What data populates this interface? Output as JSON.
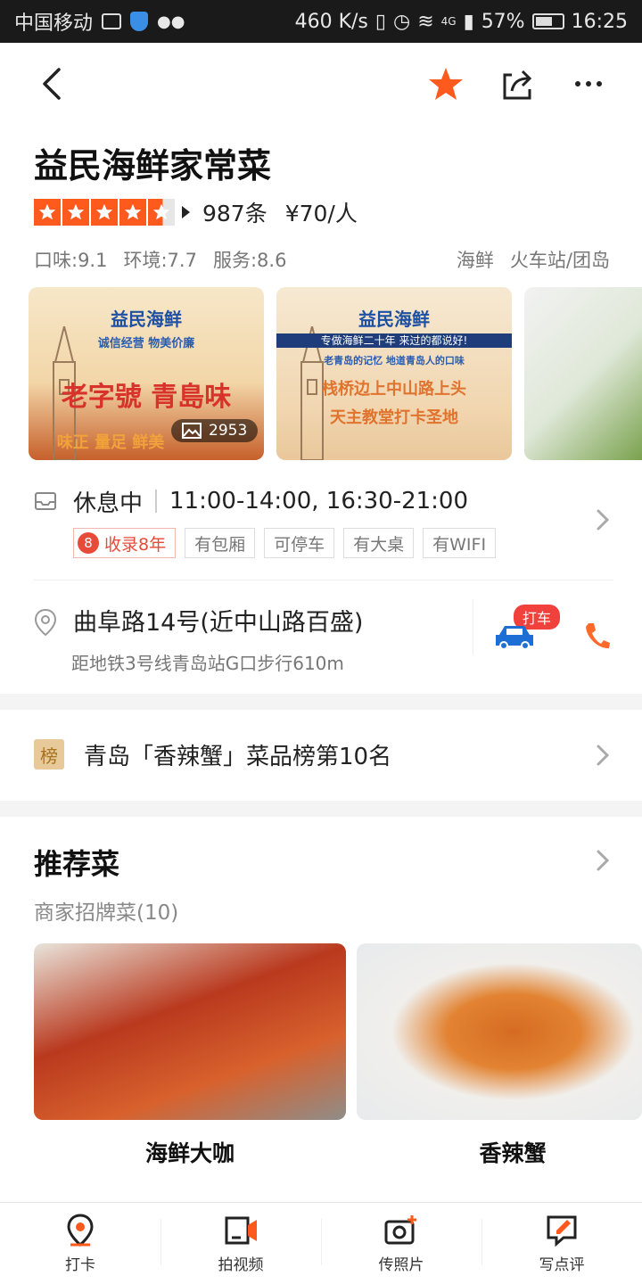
{
  "status_bar": {
    "carrier": "中国移动",
    "speed": "460 K/s",
    "network": "4G",
    "battery": "57%",
    "time": "16:25"
  },
  "nav": {
    "back_icon": "chevron-left-icon",
    "favorite_icon": "star-icon",
    "share_icon": "share-icon",
    "more_icon": "more-icon"
  },
  "shop": {
    "name": "益民海鲜家常菜",
    "rating_stars": 4.5,
    "reviews": "987条",
    "price": "¥70/人",
    "scores": {
      "taste": "口味:9.1",
      "environment": "环境:7.7",
      "service": "服务:8.6"
    },
    "category": "海鲜",
    "area": "火车站/团岛"
  },
  "photos": {
    "count": "2953",
    "photo1": {
      "title": "益民海鲜",
      "sub": "诚信经营 物美价廉",
      "slogan": "老字號 青島味",
      "slogan2": "味正 量足 鲜美"
    },
    "photo2": {
      "title": "益民海鲜",
      "band": "专做海鲜二十年 来过的都说好!",
      "sub": "老青岛的记忆 地道青岛人的口味",
      "slogan": "栈桥边上中山路上头",
      "slogan2": "天主教堂打卡圣地"
    }
  },
  "hours": {
    "status": "休息中",
    "time": "11:00-14:00, 16:30-21:00"
  },
  "tags": {
    "recorded_badge": "8",
    "recorded": "收录8年",
    "items": [
      "有包厢",
      "可停车",
      "有大桌",
      "有WIFI"
    ]
  },
  "address": {
    "main": "曲阜路14号(近中山路百盛)",
    "sub": "距地铁3号线青岛站G口步行610m",
    "taxi_label": "打车"
  },
  "ranking": {
    "icon_text": "榜",
    "text": "青岛「香辣蟹」菜品榜第10名"
  },
  "recommend": {
    "title": "推荐菜",
    "subtitle": "商家招牌菜(10)",
    "dishes": [
      {
        "name": "海鲜大咖"
      },
      {
        "name": "香辣蟹"
      }
    ]
  },
  "bottom_bar": [
    {
      "label": "打卡",
      "icon": "location-pin-icon"
    },
    {
      "label": "拍视频",
      "icon": "video-icon"
    },
    {
      "label": "传照片",
      "icon": "camera-icon"
    },
    {
      "label": "写点评",
      "icon": "edit-review-icon"
    }
  ],
  "colors": {
    "accent": "#ff5a1e",
    "link_blue": "#1d6fd6",
    "tag_red": "#e84a3a"
  }
}
